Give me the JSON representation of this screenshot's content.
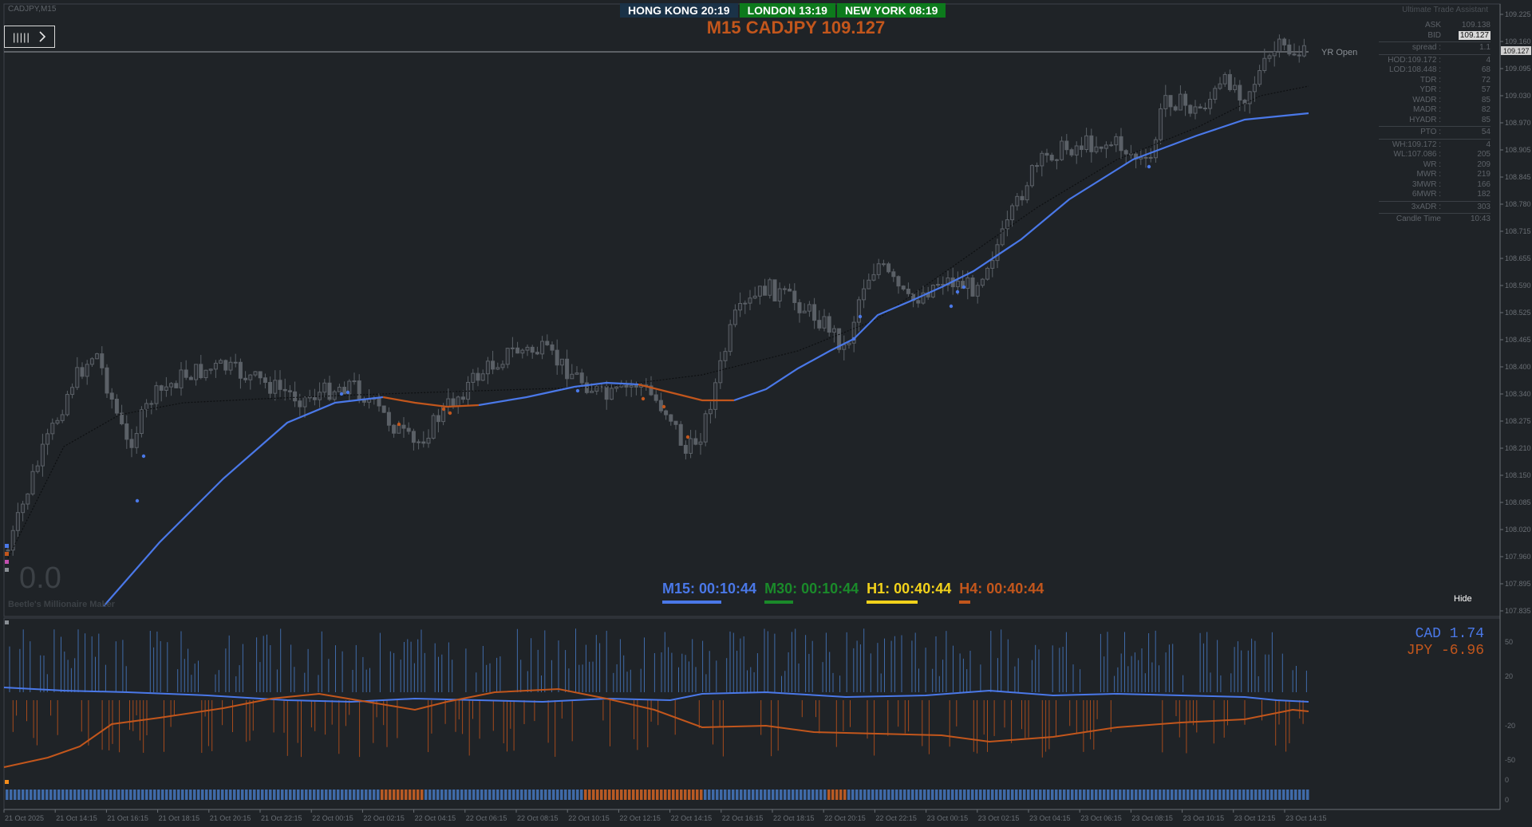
{
  "symbol_label": "CADJPY,M15",
  "title": "M15 CADJPY 109.127",
  "clocks": [
    {
      "label": "HONG KONG  20:19",
      "bg": "#1a3247"
    },
    {
      "label": "LONDON  13:19",
      "bg": "#0d7a1c"
    },
    {
      "label": "NEW YORK  08:19",
      "bg": "#0d7a1c"
    }
  ],
  "uta_title": "Ultimate Trade Assistant",
  "yr_open": "YR Open",
  "panel": {
    "groups": [
      [
        {
          "k": "ASK",
          "v": "109.138"
        },
        {
          "k": "BID",
          "v": "109.127"
        }
      ],
      [
        {
          "k": "spread :",
          "v": "1.1"
        }
      ],
      [
        {
          "k": "HOD:109.172 :",
          "v": "4"
        },
        {
          "k": "LOD:108.448 :",
          "v": "68"
        },
        {
          "k": "TDR :",
          "v": "72"
        },
        {
          "k": "YDR :",
          "v": "57"
        },
        {
          "k": "WADR :",
          "v": "85"
        },
        {
          "k": "MADR :",
          "v": "82"
        },
        {
          "k": "HYADR :",
          "v": "85"
        }
      ],
      [
        {
          "k": "PTO :",
          "v": "54"
        }
      ],
      [
        {
          "k": "WH:109.172 :",
          "v": "4"
        },
        {
          "k": "WL:107.086 :",
          "v": "205"
        },
        {
          "k": "WR :",
          "v": "209"
        },
        {
          "k": "MWR :",
          "v": "219"
        },
        {
          "k": "3MWR :",
          "v": "166"
        },
        {
          "k": "6MWR :",
          "v": "182"
        }
      ],
      [
        {
          "k": "3xADR :",
          "v": "303"
        }
      ],
      [
        {
          "k": "Candle Time",
          "v": "10:43"
        }
      ]
    ]
  },
  "timers": [
    {
      "label": "M15: 00:10:44",
      "color": "#4a78e8",
      "ul": 74
    },
    {
      "label": "M30: 00:10:44",
      "color": "#1a8a2a",
      "ul": 36
    },
    {
      "label": "H1: 00:40:44",
      "color": "#f2d21b",
      "ul": 64
    },
    {
      "label": "H4: 00:40:44",
      "color": "#c2561c",
      "ul": 14
    }
  ],
  "hide_label": "Hide",
  "zero_label": "0.0",
  "ea_label": "Beetle's Millionaire Maker",
  "strength": {
    "cad": {
      "label": "CAD  1.74",
      "color": "#4a78e8"
    },
    "jpy": {
      "label": "JPY -6.96",
      "color": "#c2561c"
    }
  },
  "price_axis": [
    "109.225",
    "109.160",
    "109.095",
    "109.030",
    "108.970",
    "108.905",
    "108.845",
    "108.780",
    "108.715",
    "108.655",
    "108.590",
    "108.525",
    "108.465",
    "108.400",
    "108.340",
    "108.275",
    "108.210",
    "108.150",
    "108.085",
    "108.020",
    "107.960",
    "107.895",
    "107.835"
  ],
  "current_price_tag": "109.127",
  "sub_axis": [
    "50",
    "20",
    "-20",
    "-50",
    "0",
    "0"
  ],
  "time_axis": [
    "21 Oct 2025",
    "21 Oct 14:15",
    "21 Oct 16:15",
    "21 Oct 18:15",
    "21 Oct 20:15",
    "21 Oct 22:15",
    "22 Oct 00:15",
    "22 Oct 02:15",
    "22 Oct 04:15",
    "22 Oct 06:15",
    "22 Oct 08:15",
    "22 Oct 10:15",
    "22 Oct 12:15",
    "22 Oct 14:15",
    "22 Oct 16:15",
    "22 Oct 18:15",
    "22 Oct 20:15",
    "22 Oct 22:15",
    "23 Oct 00:15",
    "23 Oct 02:15",
    "23 Oct 04:15",
    "23 Oct 06:15",
    "23 Oct 08:15",
    "23 Oct 10:15",
    "23 Oct 12:15",
    "23 Oct 14:15"
  ],
  "colors": {
    "bg": "#1f2327",
    "up": "#4a78e8",
    "down": "#c2561c",
    "candle": "#5b6067",
    "grid": "#3a3f44"
  }
}
